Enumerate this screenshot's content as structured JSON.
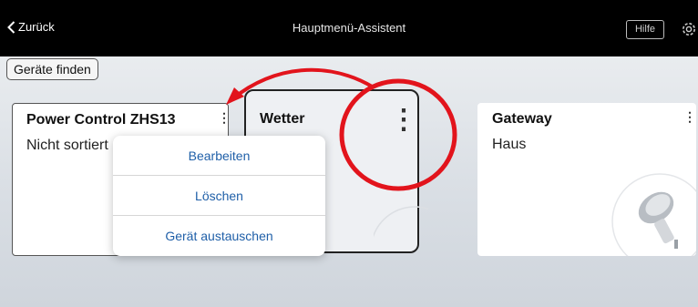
{
  "header": {
    "back_label": "Zurück",
    "title": "Hauptmenü-Assistent",
    "help_label": "Hilfe",
    "settings_icon": "gear-icon"
  },
  "toolbar": {
    "find_devices_label": "Geräte finden"
  },
  "cards": [
    {
      "title": "Power Control ZHS13",
      "subtitle": "Nicht sortiert"
    },
    {
      "title": "Wetter",
      "subtitle": ""
    },
    {
      "title": "Gateway",
      "subtitle": "Haus"
    }
  ],
  "context_menu": {
    "items": [
      "Bearbeiten",
      "Löschen",
      "Gerät austauschen"
    ]
  },
  "annotation": {
    "color": "#e2141c"
  }
}
